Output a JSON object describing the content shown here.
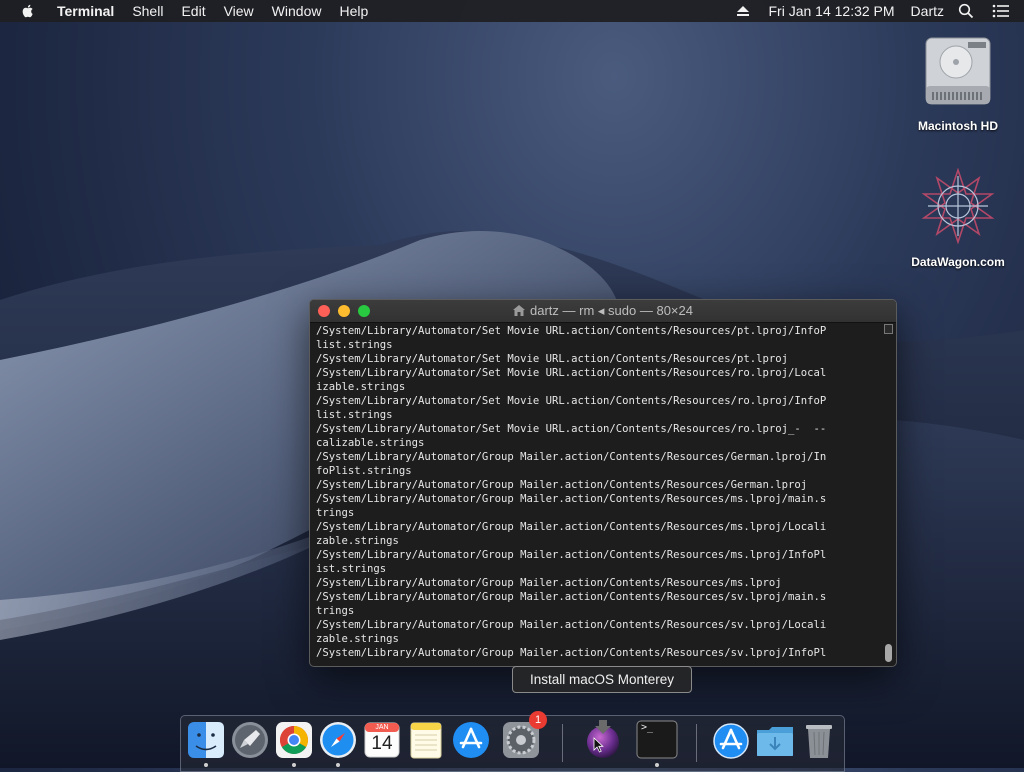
{
  "menubar": {
    "app_name": "Terminal",
    "menus": [
      "Shell",
      "Edit",
      "View",
      "Window",
      "Help"
    ],
    "date_time": "Fri Jan 14  12:32 PM",
    "user": "Dartz"
  },
  "desktop": {
    "icons": [
      {
        "label": "Macintosh HD",
        "icon": "hard-drive-icon"
      },
      {
        "label": "DataWagon.com",
        "icon": "datawagon-logo-icon"
      }
    ]
  },
  "terminal": {
    "title": "dartz — rm ◂ sudo — 80×24",
    "lines": [
      "/System/Library/Automator/Set Movie URL.action/Contents/Resources/pt.lproj/InfoP",
      "list.strings",
      "/System/Library/Automator/Set Movie URL.action/Contents/Resources/pt.lproj",
      "/System/Library/Automator/Set Movie URL.action/Contents/Resources/ro.lproj/Local",
      "izable.strings",
      "/System/Library/Automator/Set Movie URL.action/Contents/Resources/ro.lproj/InfoP",
      "list.strings",
      "/System/Library/Automator/Set Movie URL.action/Contents/Resources/ro.lproj_-  --",
      "calizable.strings",
      "/System/Library/Automator/Group Mailer.action/Contents/Resources/German.lproj/In",
      "foPlist.strings",
      "/System/Library/Automator/Group Mailer.action/Contents/Resources/German.lproj",
      "/System/Library/Automator/Group Mailer.action/Contents/Resources/ms.lproj/main.s",
      "trings",
      "/System/Library/Automator/Group Mailer.action/Contents/Resources/ms.lproj/Locali",
      "zable.strings",
      "/System/Library/Automator/Group Mailer.action/Contents/Resources/ms.lproj/InfoPl",
      "ist.strings",
      "/System/Library/Automator/Group Mailer.action/Contents/Resources/ms.lproj",
      "/System/Library/Automator/Group Mailer.action/Contents/Resources/sv.lproj/main.s",
      "trings",
      "/System/Library/Automator/Group Mailer.action/Contents/Resources/sv.lproj/Locali",
      "zable.strings",
      "/System/Library/Automator/Group Mailer.action/Contents/Resources/sv.lproj/InfoPl"
    ]
  },
  "tooltip": {
    "text": "Install macOS Monterey"
  },
  "dock": {
    "items": [
      {
        "name": "Finder",
        "icon": "finder-icon",
        "running": true
      },
      {
        "name": "Launchpad",
        "icon": "launchpad-icon",
        "running": false
      },
      {
        "name": "Google Chrome",
        "icon": "chrome-icon",
        "running": true
      },
      {
        "name": "Safari",
        "icon": "safari-icon",
        "running": true
      },
      {
        "name": "Calendar",
        "icon": "calendar-icon",
        "running": false,
        "month": "JAN",
        "day": "14"
      },
      {
        "name": "Notes",
        "icon": "notes-icon",
        "running": false
      },
      {
        "name": "App Store",
        "icon": "app-store-icon",
        "running": false
      },
      {
        "name": "System Preferences",
        "icon": "system-preferences-icon",
        "running": false,
        "badge": "1"
      },
      {
        "name": "Install macOS Monterey",
        "icon": "install-macos-icon",
        "running": false
      },
      {
        "name": "Terminal",
        "icon": "terminal-icon",
        "running": true,
        "glyph": ">_"
      },
      {
        "name": "Applications",
        "icon": "applications-folder-icon",
        "running": false
      },
      {
        "name": "Downloads",
        "icon": "downloads-folder-icon",
        "running": false
      },
      {
        "name": "Trash",
        "icon": "trash-icon",
        "running": false
      }
    ]
  },
  "colors": {
    "close": "#fe5f57",
    "minimize": "#febc2e",
    "maximize": "#28c840",
    "badge": "#ea3b32"
  }
}
